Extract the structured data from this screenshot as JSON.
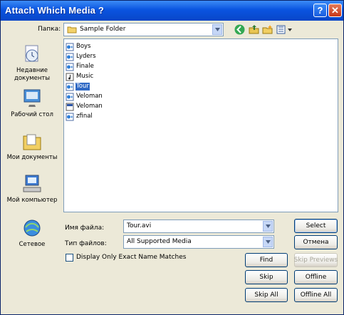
{
  "window": {
    "title": "Attach Which Media ?",
    "help": "?",
    "close": "✕"
  },
  "lookin": {
    "label": "Папка:",
    "value": "Sample Folder"
  },
  "toolbar": [
    "back-icon",
    "up-folder-icon",
    "new-folder-icon",
    "view-menu-icon"
  ],
  "places": [
    {
      "label": "Недавние документы"
    },
    {
      "label": "Рабочий стол"
    },
    {
      "label": "Мои документы"
    },
    {
      "label": "Мой компьютер"
    },
    {
      "label": "Сетевое"
    }
  ],
  "files": [
    {
      "name": "Boys",
      "icon": "video-file-icon",
      "selected": false
    },
    {
      "name": "Lyders",
      "icon": "video-file-icon",
      "selected": false
    },
    {
      "name": "Finale",
      "icon": "video-file-icon",
      "selected": false
    },
    {
      "name": "Music",
      "icon": "audio-file-icon",
      "selected": false
    },
    {
      "name": "Tour",
      "icon": "video-file-icon",
      "selected": true
    },
    {
      "name": "Veloman",
      "icon": "video-file-icon",
      "selected": false
    },
    {
      "name": "Veloman",
      "icon": "media-file-icon",
      "selected": false
    },
    {
      "name": "zfinal",
      "icon": "video-file-icon",
      "selected": false
    }
  ],
  "filename": {
    "label": "Имя файла:",
    "value": "Tour.avi"
  },
  "filetype": {
    "label": "Тип файлов:",
    "value": "All Supported Media"
  },
  "exact_match": {
    "label": "Display Only Exact Name Matches",
    "checked": false
  },
  "buttons": {
    "select": "Select",
    "cancel": "Отмена",
    "find": "Find",
    "skip_previews": "Skip Previews",
    "skip": "Skip",
    "offline": "Offline",
    "skip_all": "Skip All",
    "offline_all": "Offline All"
  }
}
